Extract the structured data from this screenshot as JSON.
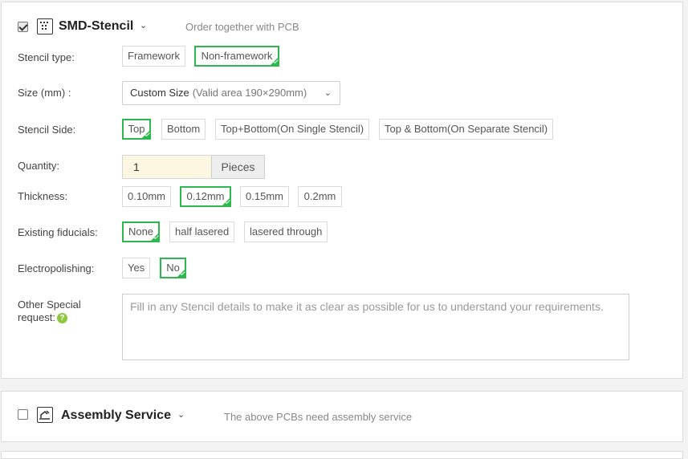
{
  "stencil": {
    "title": "SMD-Stencil",
    "subtitle": "Order together with PCB",
    "checked": true,
    "icon": "stencil-icon",
    "stencil_type": {
      "label": "Stencil type:",
      "options": [
        "Framework",
        "Non-framework"
      ],
      "selected": "Non-framework"
    },
    "size": {
      "label": "Size (mm) :",
      "value": "Custom Size",
      "hint": "(Valid area 190×290mm)"
    },
    "stencil_side": {
      "label": "Stencil Side:",
      "options": [
        "Top",
        "Bottom",
        "Top+Bottom(On Single Stencil)",
        "Top & Bottom(On Separate Stencil)"
      ],
      "selected": "Top"
    },
    "quantity": {
      "label": "Quantity:",
      "value": "1",
      "unit": "Pieces"
    },
    "thickness": {
      "label": "Thickness:",
      "options": [
        "0.10mm",
        "0.12mm",
        "0.15mm",
        "0.2mm"
      ],
      "selected": "0.12mm"
    },
    "fiducials": {
      "label": "Existing fiducials:",
      "options": [
        "None",
        "half lasered",
        "lasered through"
      ],
      "selected": "None"
    },
    "electropolishing": {
      "label": "Electropolishing:",
      "options": [
        "Yes",
        "No"
      ],
      "selected": "No"
    },
    "special": {
      "label_line1": "Other Special",
      "label_line2": "request:",
      "help": "?",
      "placeholder": "Fill in any Stencil details to make it as clear as possible for us to understand your requirements."
    }
  },
  "assembly": {
    "title": "Assembly Service",
    "subtitle": "The above PCBs need assembly service",
    "checked": false,
    "icon": "assembly-icon"
  },
  "colors": {
    "accent": "#2db84d",
    "input_bg": "#fdf7e1",
    "help": "#8dc63f"
  }
}
